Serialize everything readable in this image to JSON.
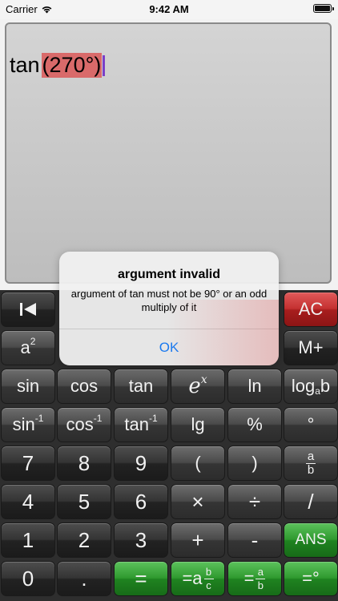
{
  "status_bar": {
    "carrier": "Carrier",
    "time": "9:42 AM"
  },
  "display": {
    "function": "tan",
    "argument": "(270°)"
  },
  "keypad": {
    "row1": {
      "back": "|◀",
      "ac": "AC"
    },
    "row2": {
      "square": "a",
      "square_sup": "2",
      "mplus": "M+"
    },
    "row3": {
      "sin": "sin",
      "cos": "cos",
      "tan": "tan",
      "exp_base": "e",
      "exp_sup": "x",
      "ln": "ln",
      "log_base": "log",
      "log_sub": "a",
      "log_b": "b"
    },
    "row4": {
      "asin": "sin",
      "acos": "cos",
      "atan": "tan",
      "inv_sup": "-1",
      "lg": "lg",
      "percent": "%",
      "degree": "°"
    },
    "row5": {
      "seven": "7",
      "eight": "8",
      "nine": "9",
      "lparen": "(",
      "rparen": ")",
      "frac_num": "a",
      "frac_den": "b"
    },
    "row6": {
      "four": "4",
      "five": "5",
      "six": "6",
      "multiply": "×",
      "divide": "÷",
      "slash": "/"
    },
    "row7": {
      "one": "1",
      "two": "2",
      "three": "3",
      "plus": "+",
      "minus": "-",
      "ans": "ANS"
    },
    "row8": {
      "zero": "0",
      "dot": ".",
      "equals": "=",
      "eq_mixed_prefix": "=a",
      "eq_mixed_num": "b",
      "eq_mixed_den": "c",
      "eq_frac_prefix": "=",
      "eq_frac_num": "a",
      "eq_frac_den": "b",
      "eq_degree": "=°"
    }
  },
  "alert": {
    "title": "argument invalid",
    "message": "argument of tan must not be 90° or an odd multiply of it",
    "ok_label": "OK"
  },
  "colors": {
    "alert_button": "#1a7af0",
    "ac_key": "#c43030",
    "equals_key": "#2f9a2f"
  }
}
